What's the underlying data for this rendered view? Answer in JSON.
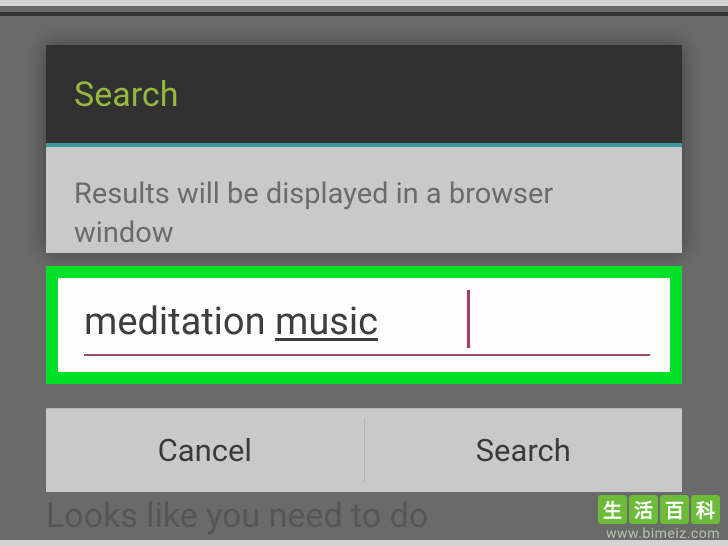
{
  "dialog": {
    "title": "Search",
    "hint": "Results will be displayed in a browser window",
    "input_word1": "meditation ",
    "input_word2": "music",
    "cancel_label": "Cancel",
    "search_label": "Search"
  },
  "background": {
    "partial_text": "Looks like you need to do"
  },
  "watermark": {
    "cn1": "生",
    "cn2": "活",
    "cn3": "百",
    "cn4": "科",
    "url": "www.bimeiz.com"
  }
}
